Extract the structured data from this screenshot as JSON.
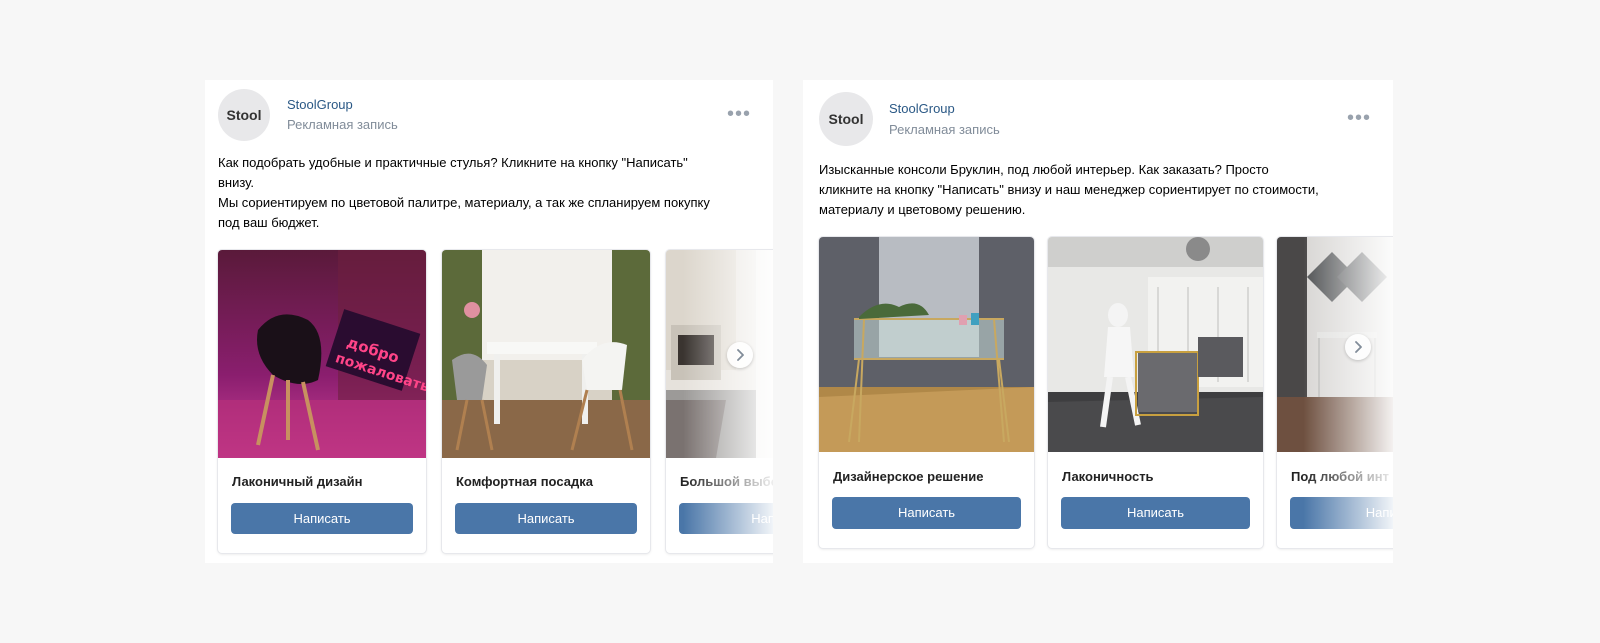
{
  "posts": [
    {
      "avatar_text": "Stool",
      "author": "StoolGroup",
      "subtitle": "Рекламная запись",
      "more_icon": "more-horizontal-icon",
      "text_lines": [
        "Как подобрать удобные и практичные стулья? Кликните на кнопку \"Написать\"",
        "внизу.",
        "Мы сориентируем по цветовой палитре, материалу, а так же спланируем покупку",
        "под ваш бюджет."
      ],
      "cards": [
        {
          "title": "Лаконичный дизайн",
          "button": "Написать",
          "image": "black chair with neon 'Добро пожаловать' sign"
        },
        {
          "title": "Комфортная посадка",
          "button": "Написать",
          "image": "white table with white chairs by window"
        },
        {
          "title": "Большой выбо",
          "button": "Напис",
          "image": "kitchen with patterned floor"
        }
      ]
    },
    {
      "avatar_text": "Stool",
      "author": "StoolGroup",
      "subtitle": "Рекламная запись",
      "more_icon": "more-horizontal-icon",
      "text_lines": [
        "Изысканные консоли Бруклин, под любой интерьер. Как заказать? Просто",
        "кликните на кнопку \"Написать\" внизу и наш менеджер сориентирует по стоимости,",
        "материалу и цветовому решению."
      ],
      "cards": [
        {
          "title": "Дизайнерское решение",
          "button": "Написать",
          "image": "glass console table with gold frame"
        },
        {
          "title": "Лаконичность",
          "button": "Написать",
          "image": "showroom with mannequin and gold console"
        },
        {
          "title": "Под любой инт",
          "button": "Напис",
          "image": "dark interior with console"
        }
      ]
    }
  ],
  "colors": {
    "background": "#f7f7f7",
    "accent_button": "#4a76a8",
    "author_link": "#2a5885",
    "muted_text": "#818c99"
  }
}
